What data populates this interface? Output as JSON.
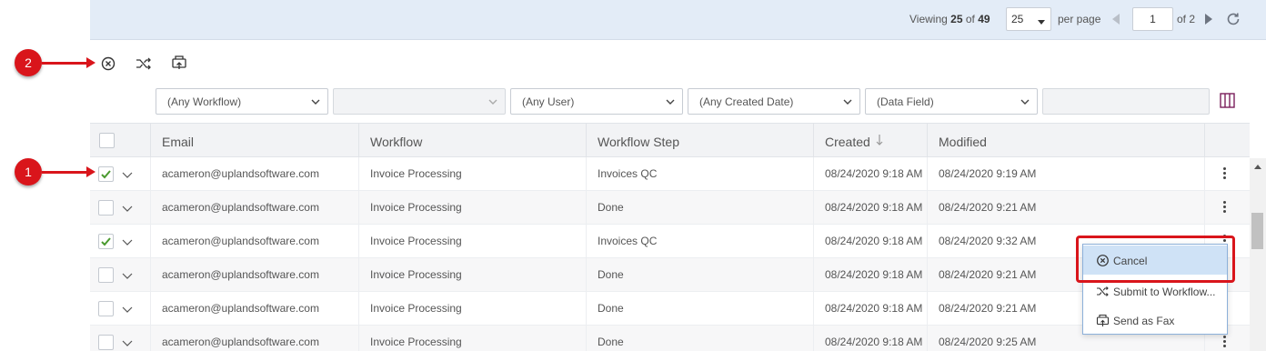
{
  "pager": {
    "viewing_prefix": "Viewing",
    "viewing_count": "25",
    "viewing_of": "of",
    "viewing_total": "49",
    "page_size": "25",
    "per_page_label": "per page",
    "current_page": "1",
    "of_pages": "of 2"
  },
  "callouts": {
    "one": "1",
    "two": "2"
  },
  "toolbar": {
    "cancel_icon": "cancel-circle-icon",
    "submit_icon": "shuffle-icon",
    "fax_icon": "fax-upload-icon"
  },
  "filters": {
    "workflow": "(Any Workflow)",
    "step": "",
    "user": "(Any User)",
    "created_date": "(Any Created Date)",
    "data_field": "(Data Field)",
    "data_value": ""
  },
  "grid": {
    "columns": [
      "Email",
      "Workflow",
      "Workflow Step",
      "Created",
      "Modified"
    ],
    "rows": [
      {
        "checked": true,
        "email": "acameron@uplandsoftware.com",
        "workflow": "Invoice Processing",
        "step": "Invoices QC",
        "created": "08/24/2020 9:18 AM",
        "modified": "08/24/2020 9:19 AM"
      },
      {
        "checked": false,
        "email": "acameron@uplandsoftware.com",
        "workflow": "Invoice Processing",
        "step": "Done",
        "created": "08/24/2020 9:18 AM",
        "modified": "08/24/2020 9:21 AM"
      },
      {
        "checked": true,
        "email": "acameron@uplandsoftware.com",
        "workflow": "Invoice Processing",
        "step": "Invoices QC",
        "created": "08/24/2020 9:18 AM",
        "modified": "08/24/2020 9:32 AM"
      },
      {
        "checked": false,
        "email": "acameron@uplandsoftware.com",
        "workflow": "Invoice Processing",
        "step": "Done",
        "created": "08/24/2020 9:18 AM",
        "modified": "08/24/2020 9:21 AM"
      },
      {
        "checked": false,
        "email": "acameron@uplandsoftware.com",
        "workflow": "Invoice Processing",
        "step": "Done",
        "created": "08/24/2020 9:18 AM",
        "modified": "08/24/2020 9:21 AM"
      },
      {
        "checked": false,
        "email": "acameron@uplandsoftware.com",
        "workflow": "Invoice Processing",
        "step": "Done",
        "created": "08/24/2020 9:18 AM",
        "modified": "08/24/2020 9:25 AM"
      }
    ]
  },
  "context_menu": {
    "items": [
      {
        "label": "Cancel",
        "icon": "cancel-circle-icon"
      },
      {
        "label": "Submit to Workflow...",
        "icon": "shuffle-icon"
      },
      {
        "label": "Send as Fax",
        "icon": "fax-upload-icon"
      }
    ]
  },
  "colors": {
    "callout_red": "#d9151b",
    "header_blue": "#e3ecf7",
    "menu_highlight": "#cfe2f6",
    "check_green": "#4a9a2f"
  }
}
